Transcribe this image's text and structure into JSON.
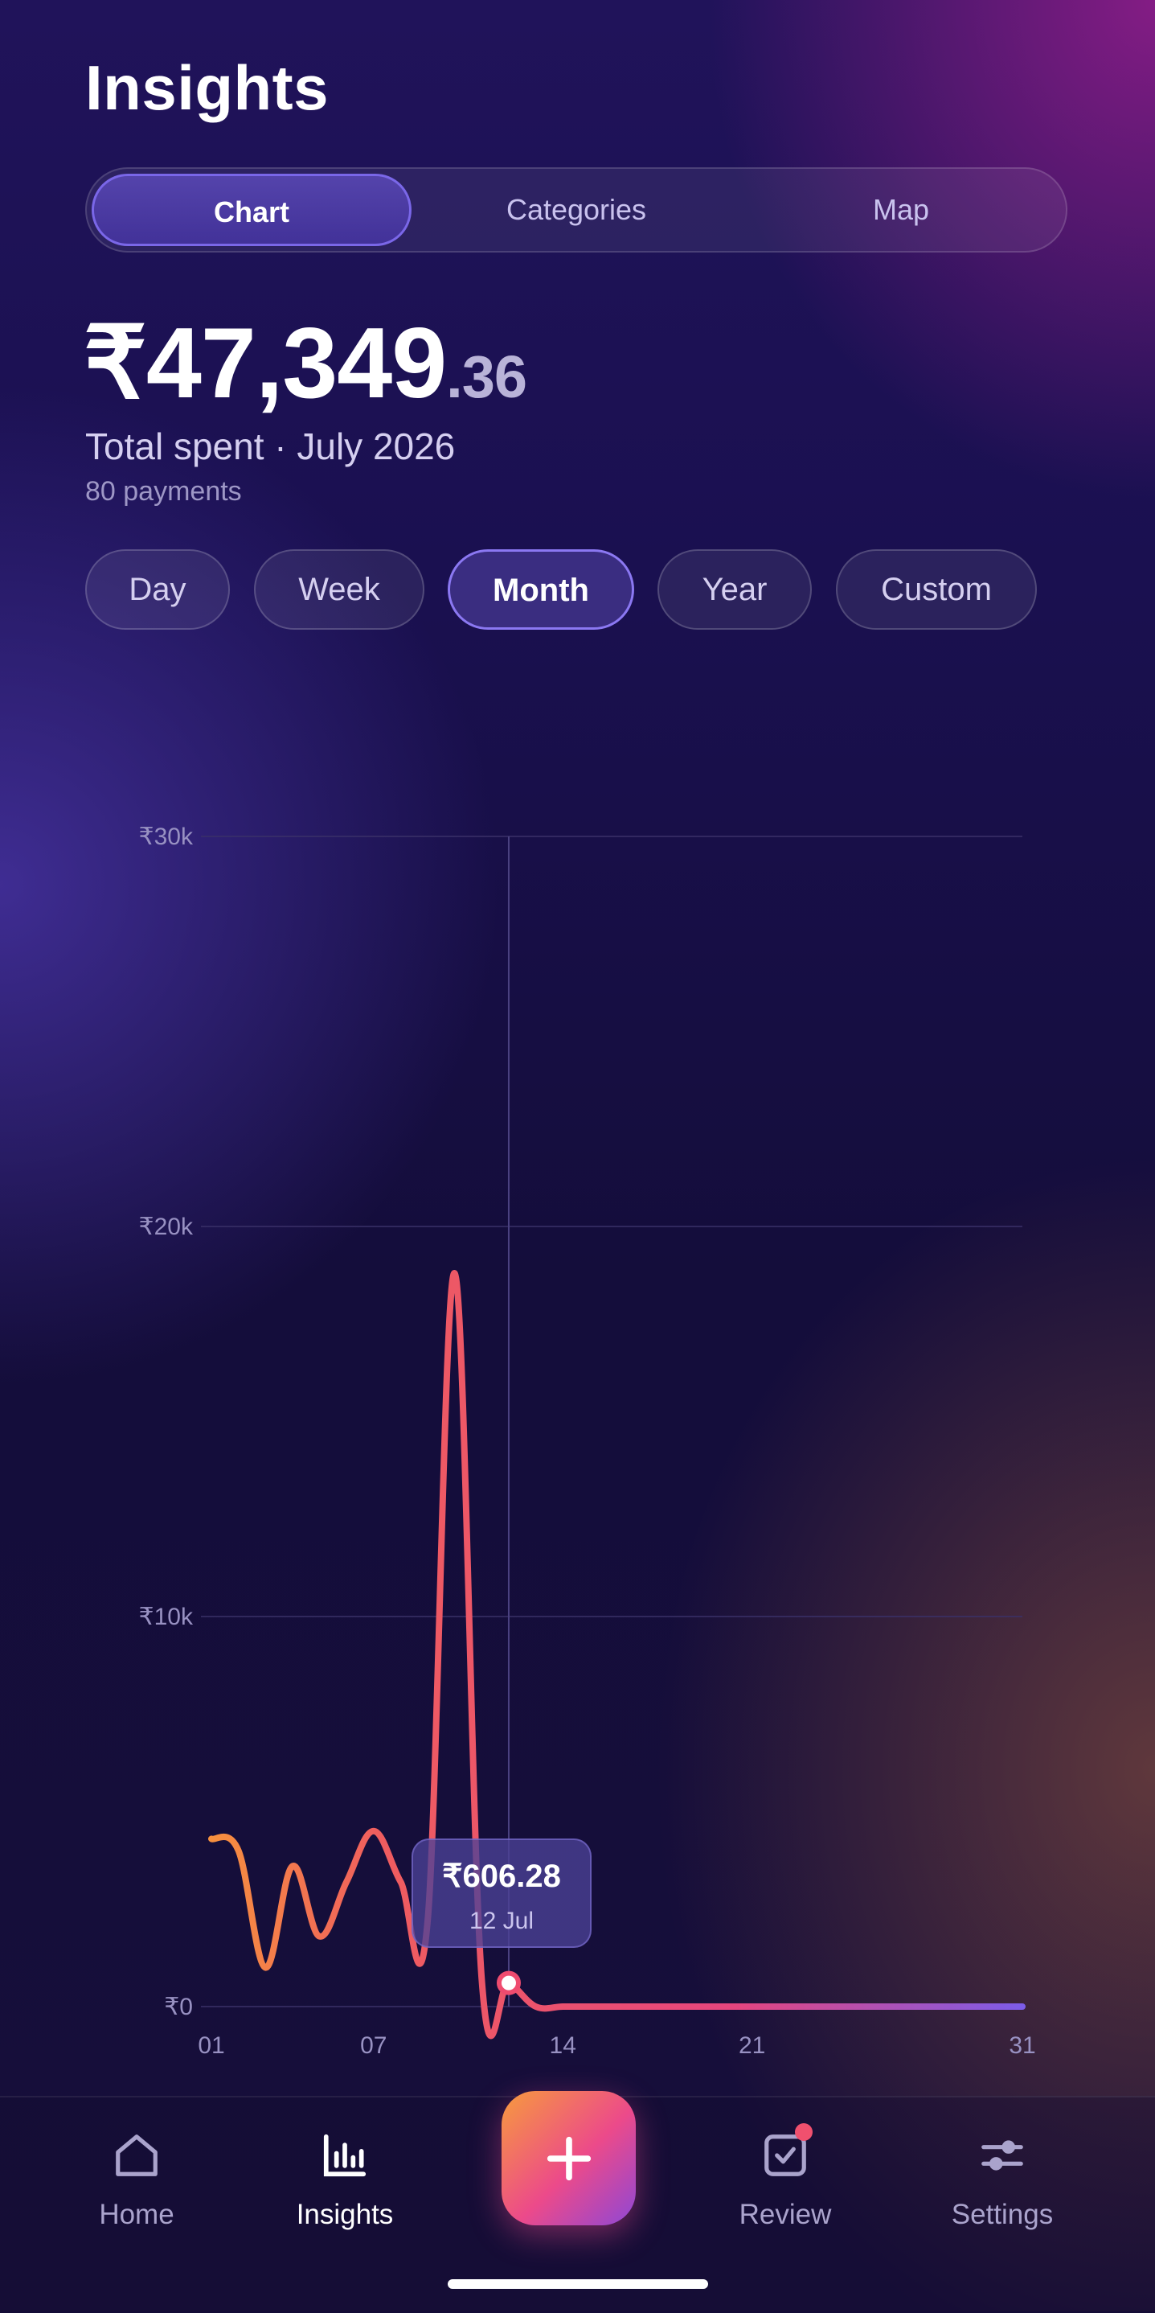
{
  "header": {
    "title": "Insights"
  },
  "tabs": [
    {
      "label": "Chart",
      "active": true
    },
    {
      "label": "Categories",
      "active": false
    },
    {
      "label": "Map",
      "active": false
    }
  ],
  "summary": {
    "amount_main": "₹47,349",
    "amount_decimal": ".36",
    "subtitle": "Total spent · July 2026",
    "count": "80 payments"
  },
  "ranges": [
    {
      "label": "Day",
      "active": false
    },
    {
      "label": "Week",
      "active": false
    },
    {
      "label": "Month",
      "active": true
    },
    {
      "label": "Year",
      "active": false
    },
    {
      "label": "Custom",
      "active": false
    }
  ],
  "chart_data": {
    "type": "line",
    "y_tick_labels": [
      "₹30k",
      "₹20k",
      "₹10k",
      "₹0"
    ],
    "x_tick_labels": [
      "01",
      "07",
      "14",
      "21",
      "31"
    ],
    "x_ticks": [
      1,
      7,
      14,
      21,
      31
    ],
    "y_ticks": [
      30000,
      20000,
      10000,
      0
    ],
    "ylim": [
      0,
      30000
    ],
    "xlim": [
      1,
      31
    ],
    "x": [
      1,
      2,
      3,
      4,
      5,
      6,
      7,
      8,
      9,
      10,
      11,
      12,
      13,
      14,
      15,
      16,
      17,
      18,
      19,
      20,
      21,
      22,
      23,
      24,
      25,
      26,
      27,
      28,
      29,
      30,
      31
    ],
    "values": [
      4300,
      4000,
      1000,
      3600,
      1800,
      3200,
      4500,
      3200,
      2200,
      18800,
      700,
      606.28,
      0,
      0,
      0,
      0,
      0,
      0,
      0,
      0,
      0,
      0,
      0,
      0,
      0,
      0,
      0,
      0,
      0,
      0,
      0
    ],
    "grid": true,
    "selected": {
      "x": 12,
      "value_label": "₹606.28",
      "date_label": "12 Jul"
    },
    "colors": {
      "start": "#f7943c",
      "mid": "#ef4b6f",
      "end": "#7c5ce8",
      "grid": "#3a3168"
    }
  },
  "bottom_nav": {
    "items": [
      {
        "label": "Home",
        "icon": "home-icon",
        "active": false
      },
      {
        "label": "Insights",
        "icon": "bar-chart-icon",
        "active": true
      },
      {
        "label": "Review",
        "icon": "checkbox-icon",
        "active": false,
        "badge": true
      },
      {
        "label": "Settings",
        "icon": "sliders-icon",
        "active": false
      }
    ],
    "fab_icon": "plus-icon"
  }
}
